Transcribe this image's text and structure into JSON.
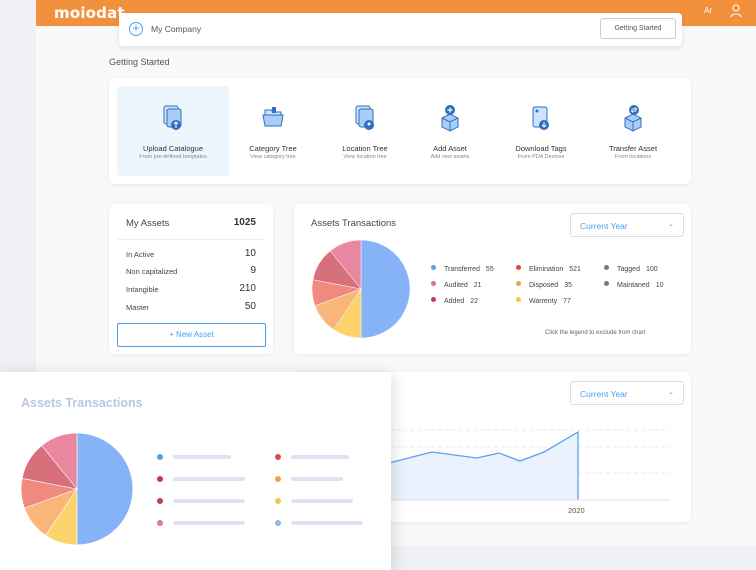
{
  "topbar": {
    "logo": "moiodat",
    "lang": "Ar",
    "user_icon": "user-icon"
  },
  "company": {
    "name": "My Company",
    "button": "Getting Started",
    "add_icon": "plus-circle-icon"
  },
  "section_title": "Getting Started",
  "quick_actions": [
    {
      "title": "Upload Catalogue",
      "sub": "From pre-defined templates",
      "icon": "upload-icon",
      "active": true
    },
    {
      "title": "Category Tree",
      "sub": "View category tree",
      "icon": "folders-icon"
    },
    {
      "title": "Location Tree",
      "sub": "View location tree",
      "icon": "location-file-icon"
    },
    {
      "title": "Add Asset",
      "sub": "Add new assets",
      "icon": "add-box-icon"
    },
    {
      "title": "Download Tags",
      "sub": "From PDA Devices",
      "icon": "download-tags-icon"
    },
    {
      "title": "Transfer Asset",
      "sub": "From locations",
      "icon": "transfer-box-icon"
    }
  ],
  "my_assets": {
    "title": "My Assets",
    "total": "1025",
    "rows": [
      {
        "label": "In Active",
        "value": "10"
      },
      {
        "label": "Non capitalized",
        "value": "9"
      },
      {
        "label": "Intangible",
        "value": "210"
      },
      {
        "label": "Master",
        "value": "50"
      }
    ],
    "new_button": "+ New Asset"
  },
  "transactions": {
    "title": "Assets Transactions",
    "select": "Current Year",
    "hint": "Click the legend to exclude from chart",
    "legend": [
      {
        "label": "Transferred",
        "value": "55",
        "color": "#5c9ff0"
      },
      {
        "label": "Audited",
        "value": "21",
        "color": "#e86b86"
      },
      {
        "label": "Added",
        "value": "22",
        "color": "#c8394b"
      },
      {
        "label": "Elimination",
        "value": "521",
        "color": "#e04848"
      },
      {
        "label": "Disposed",
        "value": "35",
        "color": "#f3a04d"
      },
      {
        "label": "Warrenty",
        "value": "77",
        "color": "#f8c840"
      },
      {
        "label": "Tagged",
        "value": "100",
        "color": "#7a7a7a"
      },
      {
        "label": "Maintaned",
        "value": "10",
        "color": "#7a7a7a"
      }
    ]
  },
  "line_card": {
    "select": "Current Year",
    "year_tick": "2020"
  },
  "popup": {
    "title": "Assets Transactions",
    "dot_colors": [
      "#5c9ff0",
      "#c8394b",
      "#c8394b",
      "#e07a8c",
      "#e04848",
      "#f3a04d",
      "#f8c840",
      "#8fb4ee"
    ]
  },
  "pie_colors": {
    "blue": "#86b3f7",
    "yellow": "#fcd26b",
    "orange": "#fab57a",
    "salmon": "#f08a7e",
    "rose": "#d7707a",
    "pink": "#e987a0"
  }
}
